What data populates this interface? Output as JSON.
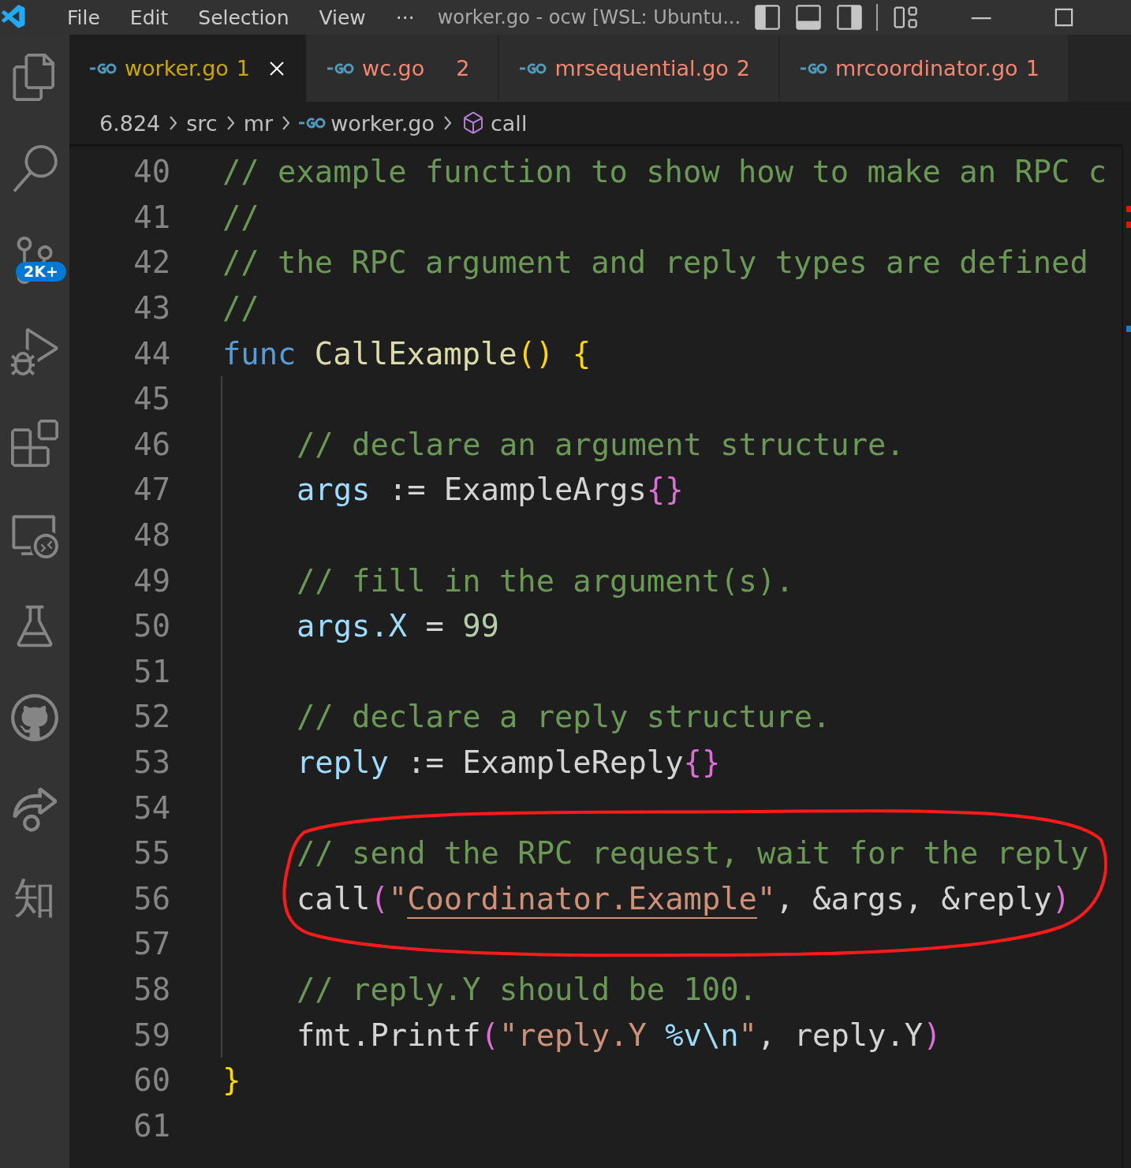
{
  "title_bar": {
    "menu": [
      "File",
      "Edit",
      "Selection",
      "View"
    ],
    "more": "···",
    "title": "worker.go - ocw [WSL: Ubuntu..."
  },
  "activity_bar": {
    "source_control_badge": "2K+",
    "extension_glyph": "知"
  },
  "tabs": [
    {
      "label": "worker.go",
      "problems": "1",
      "kind": "warning",
      "selected": true
    },
    {
      "label": "wc.go",
      "problems": "2",
      "kind": "error",
      "selected": false
    },
    {
      "label": "mrsequential.go",
      "problems": "2",
      "kind": "error",
      "selected": false
    },
    {
      "label": "mrcoordinator.go",
      "problems": "1",
      "kind": "error",
      "selected": false
    }
  ],
  "breadcrumb": [
    {
      "label": "6.824",
      "kind": "folder"
    },
    {
      "label": "src",
      "kind": "folder"
    },
    {
      "label": "mr",
      "kind": "folder"
    },
    {
      "label": "worker.go",
      "kind": "file"
    },
    {
      "label": "call",
      "kind": "symbol"
    }
  ],
  "editor": {
    "lines": [
      {
        "number": "40",
        "indented": false,
        "tokens": [
          {
            "text": "// example function to show how to make an RPC c",
            "kind": "comment"
          }
        ]
      },
      {
        "number": "41",
        "indented": false,
        "tokens": [
          {
            "text": "//",
            "kind": "comment"
          }
        ]
      },
      {
        "number": "42",
        "indented": false,
        "tokens": [
          {
            "text": "// the RPC argument and reply types are defined",
            "kind": "comment"
          }
        ]
      },
      {
        "number": "43",
        "indented": false,
        "tokens": [
          {
            "text": "//",
            "kind": "comment"
          }
        ]
      },
      {
        "number": "44",
        "indented": false,
        "tokens": [
          {
            "text": "func ",
            "kind": "keyword"
          },
          {
            "text": "CallExample",
            "kind": "function"
          },
          {
            "text": "() {",
            "kind": "bracket1"
          }
        ]
      },
      {
        "number": "45",
        "indented": true
      },
      {
        "number": "46",
        "indented": true,
        "tokens": [
          {
            "text": "// declare an argument structure.",
            "kind": "comment"
          }
        ]
      },
      {
        "number": "47",
        "indented": true,
        "tokens": [
          {
            "text": "args",
            "kind": "variable"
          },
          {
            "text": " := ExampleArgs",
            "kind": "plain"
          },
          {
            "text": "{}",
            "kind": "bracket2"
          }
        ]
      },
      {
        "number": "48",
        "indented": true
      },
      {
        "number": "49",
        "indented": true,
        "tokens": [
          {
            "text": "// fill in the argument(s).",
            "kind": "comment"
          }
        ]
      },
      {
        "number": "50",
        "indented": true,
        "tokens": [
          {
            "text": "args.X",
            "kind": "variable"
          },
          {
            "text": " = ",
            "kind": "plain"
          },
          {
            "text": "99",
            "kind": "number"
          }
        ]
      },
      {
        "number": "51",
        "indented": true
      },
      {
        "number": "52",
        "indented": true,
        "tokens": [
          {
            "text": "// declare a reply structure.",
            "kind": "comment"
          }
        ]
      },
      {
        "number": "53",
        "indented": true,
        "tokens": [
          {
            "text": "reply",
            "kind": "variable"
          },
          {
            "text": " := ExampleReply",
            "kind": "plain"
          },
          {
            "text": "{}",
            "kind": "bracket2"
          }
        ]
      },
      {
        "number": "54",
        "indented": true
      },
      {
        "number": "55",
        "indented": true,
        "tokens": [
          {
            "text": "// send the RPC request, wait for the reply",
            "kind": "comment"
          }
        ]
      },
      {
        "number": "56",
        "indented": true,
        "tokens": [
          {
            "text": "call",
            "kind": "plain"
          },
          {
            "text": "(",
            "kind": "bracket2"
          },
          {
            "text": "\"",
            "kind": "string"
          },
          {
            "text": "Coordinator.Example",
            "kind": "link"
          },
          {
            "text": "\"",
            "kind": "string"
          },
          {
            "text": ", &args, &reply",
            "kind": "plain"
          },
          {
            "text": ")",
            "kind": "bracket2"
          }
        ]
      },
      {
        "number": "57",
        "indented": true
      },
      {
        "number": "58",
        "indented": true,
        "tokens": [
          {
            "text": "// reply.Y should be 100.",
            "kind": "comment"
          }
        ]
      },
      {
        "number": "59",
        "indented": true,
        "tokens": [
          {
            "text": "fmt.Printf",
            "kind": "plain"
          },
          {
            "text": "(",
            "kind": "bracket2"
          },
          {
            "text": "\"reply.Y ",
            "kind": "string"
          },
          {
            "text": "%v\\n",
            "kind": "escape"
          },
          {
            "text": "\"",
            "kind": "string"
          },
          {
            "text": ", reply.Y",
            "kind": "plain"
          },
          {
            "text": ")",
            "kind": "bracket2"
          }
        ]
      },
      {
        "number": "60",
        "indented": false,
        "tokens": [
          {
            "text": "}",
            "kind": "bracket1"
          }
        ]
      },
      {
        "number": "61",
        "indented": false
      }
    ]
  }
}
